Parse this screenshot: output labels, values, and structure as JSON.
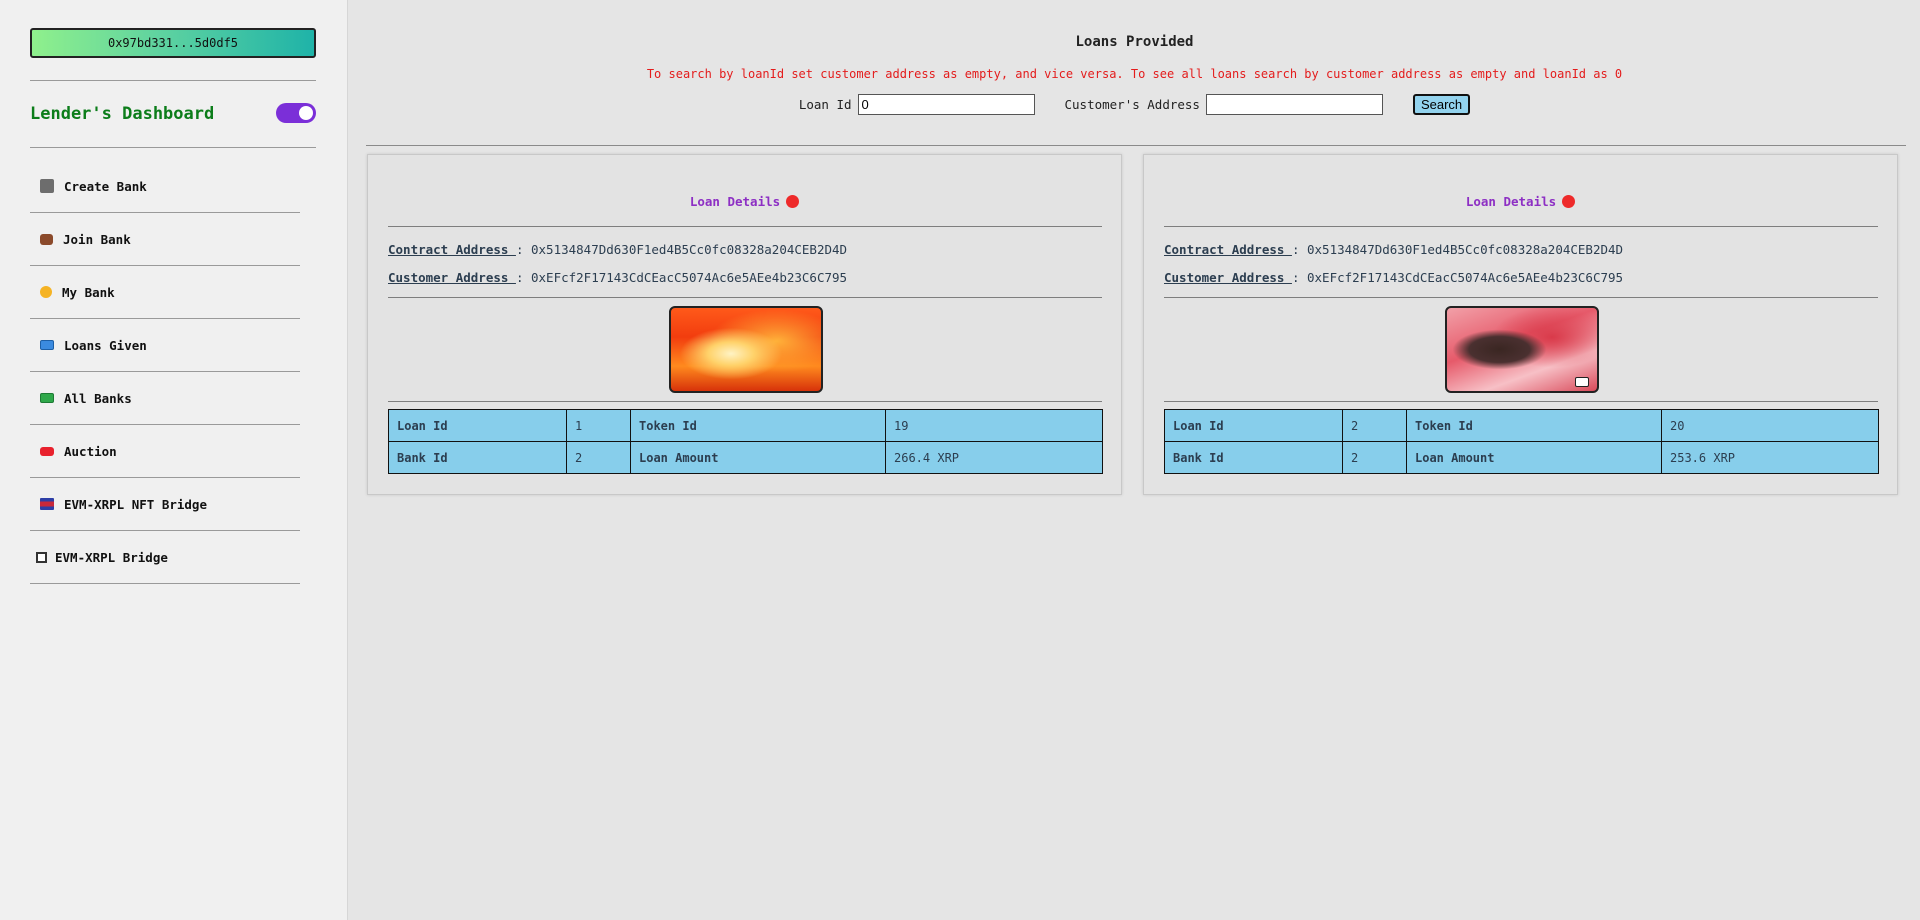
{
  "wallet": {
    "address": "0x97bd331...5d0df5"
  },
  "sidebar": {
    "title": "Lender's Dashboard",
    "items": [
      {
        "label": "Create Bank",
        "icon": "bank-icon"
      },
      {
        "label": "Join Bank",
        "icon": "briefcase-icon"
      },
      {
        "label": "My Bank",
        "icon": "coin-icon"
      },
      {
        "label": "Loans Given",
        "icon": "card-icon"
      },
      {
        "label": "All Banks",
        "icon": "cash-icon"
      },
      {
        "label": "Auction",
        "icon": "auction-icon"
      },
      {
        "label": "EVM-XRPL NFT Bridge",
        "icon": "flag-icon"
      },
      {
        "label": "EVM-XRPL Bridge",
        "icon": "box-icon"
      }
    ]
  },
  "main": {
    "title": "Loans Provided",
    "hint": "To search by loanId set customer address as empty, and vice versa. To see all loans search by customer address as empty and loanId as 0",
    "search": {
      "loan_id_label": "Loan Id",
      "loan_id_value": "0",
      "customer_label": "Customer's Address",
      "customer_value": "",
      "button_label": "Search"
    },
    "cards": [
      {
        "header": "Loan Details",
        "contract_label": "Contract Address ",
        "contract_value": ": 0x5134847Dd630F1ed4B5Cc0fc08328a204CEB2D4D",
        "customer_label": "Customer Address ",
        "customer_value": ": 0xEFcf2F17143CdCEacC5074Ac6e5AEe4b23C6C795",
        "table": {
          "loan_id_label": "Loan Id",
          "loan_id": "1",
          "token_id_label": "Token Id",
          "token_id": "19",
          "bank_id_label": "Bank Id",
          "bank_id": "2",
          "loan_amount_label": "Loan Amount",
          "loan_amount": "266.4 XRP"
        }
      },
      {
        "header": "Loan Details",
        "contract_label": "Contract Address ",
        "contract_value": ": 0x5134847Dd630F1ed4B5Cc0fc08328a204CEB2D4D",
        "customer_label": "Customer Address ",
        "customer_value": ": 0xEFcf2F17143CdCEacC5074Ac6e5AEe4b23C6C795",
        "table": {
          "loan_id_label": "Loan Id",
          "loan_id": "2",
          "token_id_label": "Token Id",
          "token_id": "20",
          "bank_id_label": "Bank Id",
          "bank_id": "2",
          "loan_amount_label": "Loan Amount",
          "loan_amount": "253.6 XRP"
        }
      }
    ]
  },
  "colors": {
    "dashboard_title": "#0c7d1a",
    "toggle": "#7b2fd8",
    "hint": "#e41c1c",
    "card_header": "#8d2fc4",
    "status_dot": "#ee2a2a",
    "table_bg": "#87ceeb"
  }
}
